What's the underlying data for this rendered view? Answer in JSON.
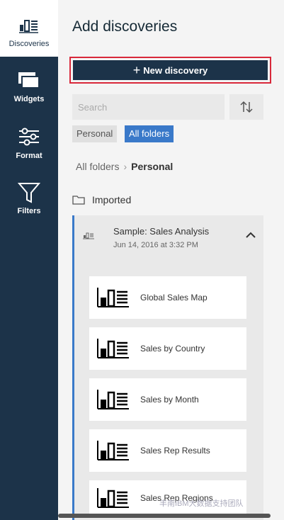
{
  "sidebar": {
    "items": [
      {
        "label": "Discoveries"
      },
      {
        "label": "Widgets"
      },
      {
        "label": "Format"
      },
      {
        "label": "Filters"
      }
    ]
  },
  "main": {
    "title": "Add discoveries",
    "new_button_label": "New discovery",
    "search_placeholder": "Search",
    "chips": [
      "Personal",
      "All folders"
    ],
    "breadcrumb": {
      "root": "All folders",
      "current": "Personal"
    },
    "folder": "Imported",
    "expanded": {
      "title": "Sample: Sales Analysis",
      "date": "Jun 14, 2016 at 3:32 PM"
    },
    "cards": [
      "Global Sales Map",
      "Sales by Country",
      "Sales by Month",
      "Sales Rep Results",
      "Sales Rep Regions"
    ]
  },
  "watermark": "丰南IBM大数据支持团队",
  "colors": {
    "sidebar": "#1c3349",
    "accent": "#3a79c9",
    "highlight": "#d8283a"
  }
}
